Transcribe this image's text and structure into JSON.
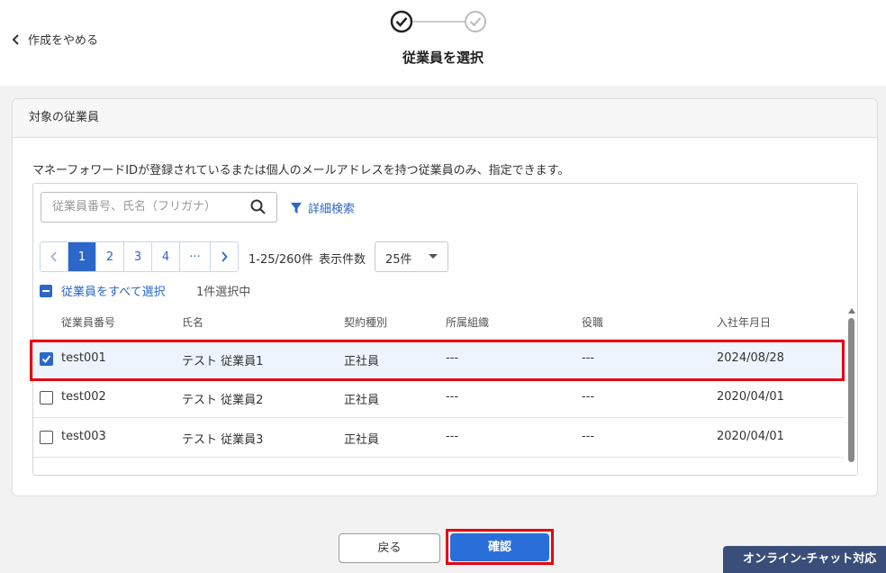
{
  "header": {
    "back_label": "作成をやめる",
    "step_title": "従業員を選択"
  },
  "card": {
    "title": "対象の従業員",
    "description": "マネーフォワードIDが登録されているまたは個人のメールアドレスを持つ従業員のみ、指定できます。"
  },
  "search": {
    "placeholder": "従業員番号、氏名（フリガナ）",
    "advanced_label": "詳細検索"
  },
  "pagination": {
    "pages": [
      "1",
      "2",
      "3",
      "4",
      "···"
    ],
    "current": "1",
    "range_text": "1-25/260件",
    "per_page_label": "表示件数",
    "per_page_value": "25件"
  },
  "selection": {
    "select_all_label": "従業員をすべて選択",
    "selected_count": "1件選択中"
  },
  "table": {
    "columns": [
      "従業員番号",
      "氏名",
      "契約種別",
      "所属組織",
      "役職",
      "入社年月日"
    ],
    "rows": [
      {
        "checked": true,
        "id": "test001",
        "name": "テスト 従業員1",
        "contract": "正社員",
        "org": "---",
        "title": "---",
        "joined": "2024/08/28"
      },
      {
        "checked": false,
        "id": "test002",
        "name": "テスト 従業員2",
        "contract": "正社員",
        "org": "---",
        "title": "---",
        "joined": "2020/04/01"
      },
      {
        "checked": false,
        "id": "test003",
        "name": "テスト 従業員3",
        "contract": "正社員",
        "org": "---",
        "title": "---",
        "joined": "2020/04/01"
      }
    ]
  },
  "footer": {
    "back_button": "戻る",
    "confirm_button": "確認",
    "chat_button": "オンライン-チャット対応"
  },
  "colors": {
    "accent": "#2a67c9",
    "highlight": "#e60012"
  }
}
